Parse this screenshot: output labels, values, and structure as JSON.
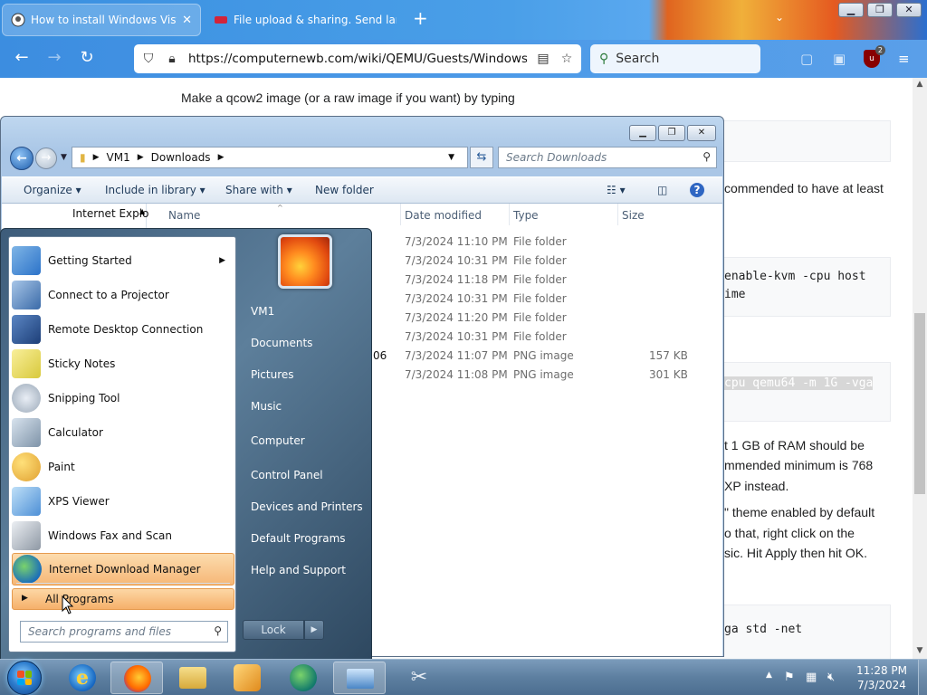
{
  "browser": {
    "tabs": [
      {
        "title": "How to install Windows Vista on",
        "active": true
      },
      {
        "title": "File upload & sharing. Send larg",
        "active": false
      }
    ],
    "new_tab": "+",
    "tabs_menu": "⌄",
    "url": "https://computernewb.com/wiki/QEMU/Guests/Windows_Vis",
    "search_placeholder": "Search",
    "extension_badge": "2",
    "window_controls": [
      "▁",
      "❐",
      "✕"
    ]
  },
  "page": {
    "line1": "Make a qcow2 image (or a raw image if you want) by typing",
    "line_ram": "commended to have at least",
    "code1_line1": "enable-kvm -cpu host",
    "code1_line2": "ime",
    "code2_line1": "cpu qemu64 -m 1G -vga",
    "para1_line1": "t 1 GB of RAM should be",
    "para1_line2": "mmended minimum is 768",
    "para1_line3": "XP instead.",
    "para2_line1": "\" theme enabled by default",
    "para2_line2": "o that, right click on the",
    "para2_line3": "sic. Hit Apply then hit OK.",
    "code3_line1": "ga std -net"
  },
  "explorer": {
    "breadcrumb": [
      "VM1",
      "Downloads"
    ],
    "search_placeholder": "Search Downloads",
    "commands": [
      "Organize",
      "Include in library",
      "Share with",
      "New folder"
    ],
    "nav_items": [
      "Internet Explo"
    ],
    "columns": [
      "Name",
      "Date modified",
      "Type",
      "Size"
    ],
    "rows": [
      {
        "name": "",
        "date": "7/3/2024 11:10 PM",
        "type": "File folder",
        "size": ""
      },
      {
        "name": "",
        "date": "7/3/2024 10:31 PM",
        "type": "File folder",
        "size": ""
      },
      {
        "name": "",
        "date": "7/3/2024 11:18 PM",
        "type": "File folder",
        "size": ""
      },
      {
        "name": "",
        "date": "7/3/2024 10:31 PM",
        "type": "File folder",
        "size": ""
      },
      {
        "name": "",
        "date": "7/3/2024 11:20 PM",
        "type": "File folder",
        "size": ""
      },
      {
        "name": "",
        "date": "7/3/2024 10:31 PM",
        "type": "File folder",
        "size": ""
      },
      {
        "name": "06",
        "date": "7/3/2024 11:07 PM",
        "type": "PNG image",
        "size": "157 KB"
      },
      {
        "name": "",
        "date": "7/3/2024 11:08 PM",
        "type": "PNG image",
        "size": "301 KB"
      }
    ]
  },
  "start_menu": {
    "programs": [
      {
        "label": "Getting Started",
        "icon": "getting-started-icon",
        "submenu": true
      },
      {
        "label": "Connect to a Projector",
        "icon": "projector-icon"
      },
      {
        "label": "Remote Desktop Connection",
        "icon": "remote-desktop-icon"
      },
      {
        "label": "Sticky Notes",
        "icon": "sticky-notes-icon"
      },
      {
        "label": "Snipping Tool",
        "icon": "scissors-icon"
      },
      {
        "label": "Calculator",
        "icon": "calculator-icon"
      },
      {
        "label": "Paint",
        "icon": "paint-icon"
      },
      {
        "label": "XPS Viewer",
        "icon": "xps-viewer-icon"
      },
      {
        "label": "Windows Fax and Scan",
        "icon": "fax-icon"
      },
      {
        "label": "Internet Download Manager",
        "icon": "idm-icon",
        "highlighted": true
      }
    ],
    "all_programs": "All Programs",
    "search_placeholder": "Search programs and files",
    "right_items": [
      "VM1",
      "Documents",
      "Pictures",
      "Music",
      "Computer",
      "Control Panel",
      "Devices and Printers",
      "Default Programs",
      "Help and Support"
    ],
    "lock_label": "Lock"
  },
  "taskbar": {
    "time": "11:28 PM",
    "date": "7/3/2024"
  }
}
